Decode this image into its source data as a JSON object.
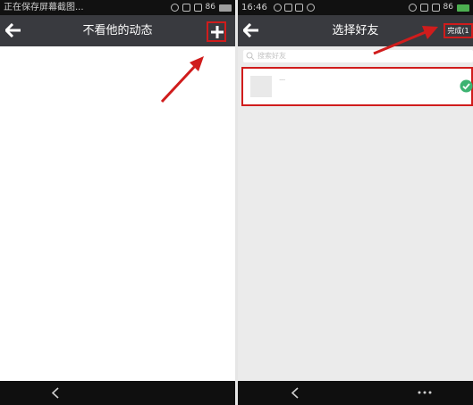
{
  "left_screen": {
    "status_left": "正在保存屏幕截图...",
    "status_right": "86",
    "title": "不看他的动态",
    "icons": {
      "back": "back-arrow-icon",
      "add": "plus-icon",
      "nav_back": "chevron-left-icon"
    }
  },
  "right_screen": {
    "status_time": "16:46",
    "status_right": "86",
    "title": "选择好友",
    "done_label": "完成(1",
    "search_placeholder": "搜索好友",
    "friends": [
      {
        "name": "·······",
        "checked": true
      }
    ],
    "icons": {
      "back": "back-arrow-icon",
      "search": "search-icon",
      "check": "check-circle-icon",
      "nav_back": "chevron-left-icon",
      "more": "more-dots-icon"
    }
  },
  "colors": {
    "appbar": "#393a3f",
    "statusbar": "#111111",
    "navbar": "#0f0f0f",
    "highlight": "#d01c1c",
    "check": "#3cb371",
    "content_bg_right": "#ebebeb"
  }
}
